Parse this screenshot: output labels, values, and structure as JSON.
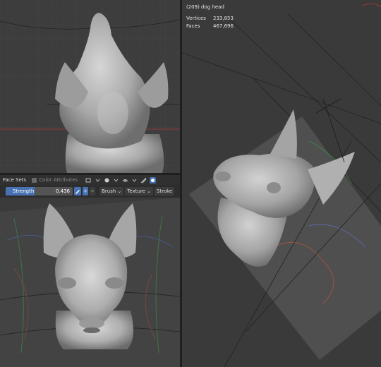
{
  "right_viewport": {
    "object_name": "(209) dog head",
    "stats": [
      {
        "label": "Vertices",
        "value": "233,853"
      },
      {
        "label": "Faces",
        "value": "467,696"
      }
    ]
  },
  "header": {
    "face_sets_label": "Face Sets",
    "color_attributes_label": "Color Attributes"
  },
  "tool_settings": {
    "strength_label": "Strength",
    "strength_value": "0.436",
    "strength_fraction": 0.436,
    "plus_label": "+",
    "minus_label": "−",
    "brush_label": "Brush",
    "texture_label": "Texture",
    "stroke_label": "Stroke"
  },
  "icons": [
    "pressure-pen-icon",
    "plus-icon",
    "minus-icon",
    "dropdown-arrow-icon",
    "viewport-shading-icon",
    "overlay-icon",
    "gizmo-icon"
  ],
  "colors": {
    "accent": "#4772b3",
    "viewport_bg": "#3d3d3d",
    "axis_red": "#9b3a3a"
  }
}
